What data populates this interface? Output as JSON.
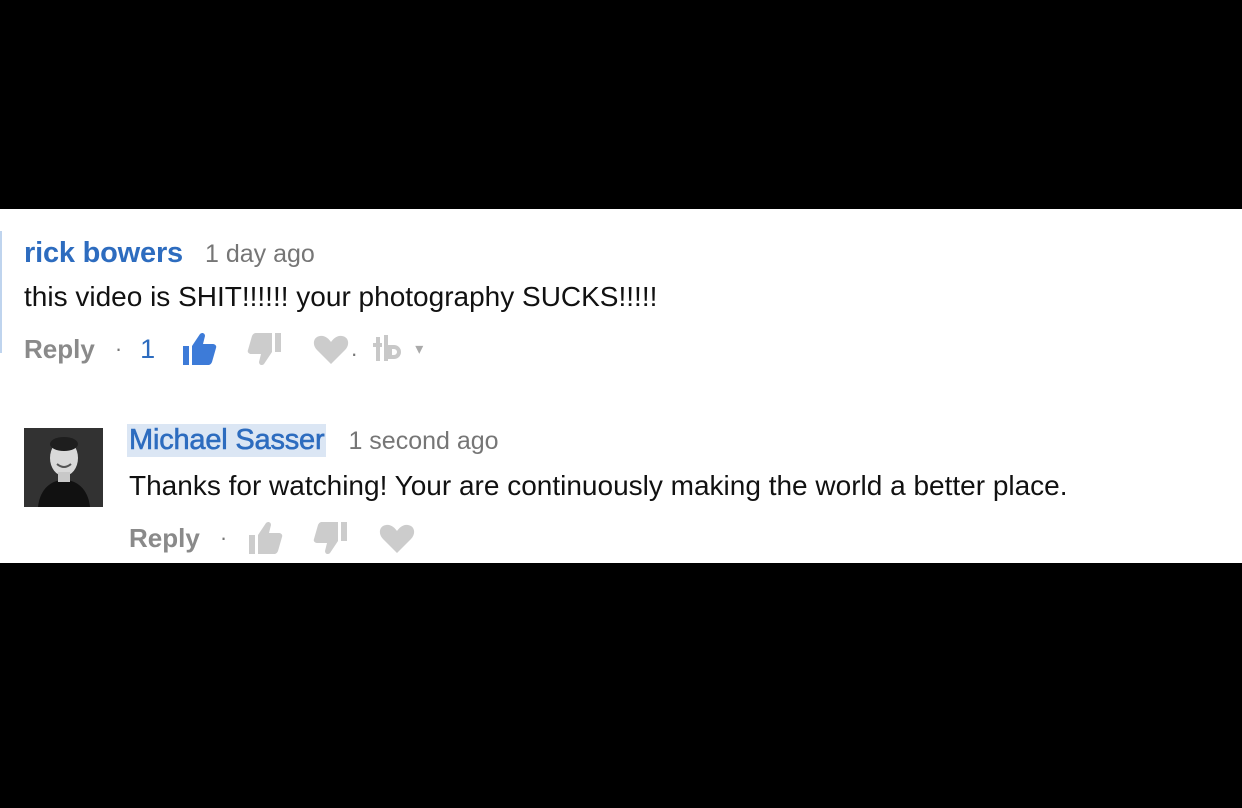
{
  "comments": [
    {
      "author": "rick bowers",
      "time": "1 day ago",
      "text": "this video is SHIT!!!!!! your photography SUCKS!!!!!",
      "reply_label": "Reply",
      "separator": "·",
      "like_count": "1",
      "liked": true,
      "icons": [
        "thumbs-up-icon",
        "thumbs-down-icon",
        "heart-icon",
        "tubebuddy-icon",
        "caret-down-icon"
      ],
      "caret": "▾"
    },
    {
      "author": "Michael Sasser",
      "time": "1 second ago",
      "text": "Thanks for watching! Your are continuously making the world a better place.",
      "reply_label": "Reply",
      "separator": "·",
      "icons": [
        "thumbs-up-icon",
        "thumbs-down-icon",
        "heart-icon"
      ]
    }
  ],
  "colors": {
    "author": "#2d6cbf",
    "liked": "#3d7bd8",
    "inactive_icon": "#cccccc",
    "background": "#000000",
    "panel": "#ffffff"
  }
}
